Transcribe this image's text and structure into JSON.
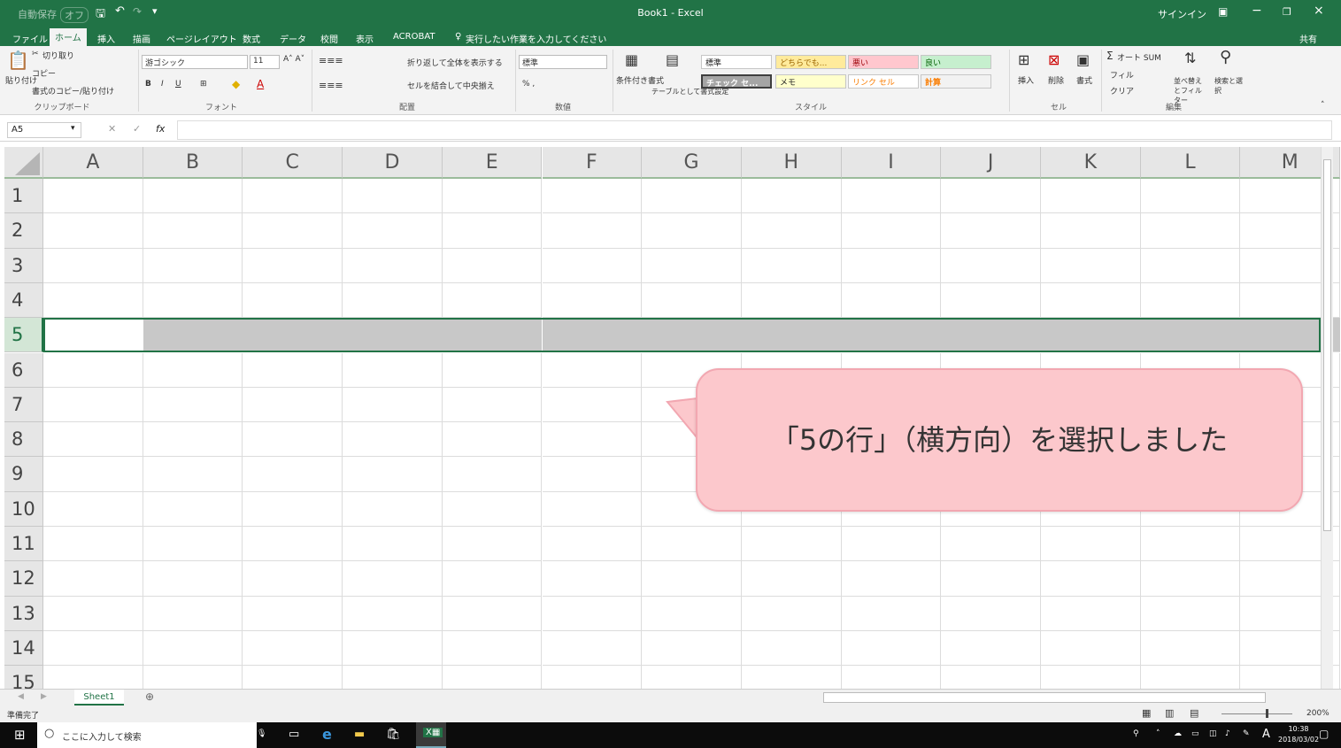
{
  "title_bar": {
    "autosave": "自動保存",
    "autosave_state": "オフ",
    "title": "Book1 - Excel",
    "signin": "サインイン"
  },
  "tabs": [
    "ファイル",
    "ホーム",
    "挿入",
    "描画",
    "ページレイアウト",
    "数式",
    "データ",
    "校閲",
    "表示",
    "ACROBAT"
  ],
  "tell_me": "実行したい作業を入力してください",
  "share": "共有",
  "ribbon": {
    "clipboard": {
      "paste": "貼り付け",
      "cut": "切り取り",
      "copy": "コピー",
      "format_painter": "書式のコピー/貼り付け",
      "label": "クリップボード"
    },
    "font": {
      "name": "游ゴシック",
      "size": "11",
      "label": "フォント"
    },
    "alignment": {
      "wrap": "折り返して全体を表示する",
      "merge": "セルを結合して中央揃え",
      "label": "配置"
    },
    "number": {
      "format": "標準",
      "label": "数値"
    },
    "styles": {
      "conditional": "条件付き書式",
      "table": "テーブルとして書式設定",
      "cells": [
        {
          "text": "標準",
          "bg": "#ffffff",
          "fg": "#222222"
        },
        {
          "text": "どちらでも...",
          "bg": "#ffeb9c",
          "fg": "#9c6500"
        },
        {
          "text": "悪い",
          "bg": "#ffc7ce",
          "fg": "#9c0006"
        },
        {
          "text": "良い",
          "bg": "#c6efce",
          "fg": "#006100"
        },
        {
          "text": "チェック セ...",
          "bg": "#a5a5a5",
          "fg": "#ffffff"
        },
        {
          "text": "メモ",
          "bg": "#ffffcc",
          "fg": "#222222"
        },
        {
          "text": "リンク セル",
          "bg": "#ffffff",
          "fg": "#fa7d00"
        },
        {
          "text": "計算",
          "bg": "#f2f2f2",
          "fg": "#fa7d00"
        }
      ],
      "label": "スタイル"
    },
    "cells": {
      "insert": "挿入",
      "delete": "削除",
      "format": "書式",
      "label": "セル"
    },
    "editing": {
      "autosum": "オート SUM",
      "fill": "フィル",
      "clear": "クリア",
      "sort": "並べ替えとフィルター",
      "find": "検索と選択",
      "label": "編集"
    }
  },
  "formula_bar": {
    "name_box": "A5",
    "fx": "fx",
    "value": ""
  },
  "columns": [
    "A",
    "B",
    "C",
    "D",
    "E",
    "F",
    "G",
    "H",
    "I",
    "J",
    "K",
    "L",
    "M"
  ],
  "rows": [
    "1",
    "2",
    "3",
    "4",
    "5",
    "6",
    "7",
    "8",
    "9",
    "10",
    "11",
    "12",
    "13",
    "14",
    "15"
  ],
  "selected_row": "5",
  "callout": "「5の行」（横方向）を選択しました",
  "sheet_tab": "Sheet1",
  "status": {
    "ready": "準備完了",
    "zoom": "200%"
  },
  "taskbar": {
    "search": "ここに入力して検索",
    "time": "10:38",
    "date": "2018/03/02",
    "ime": "A"
  },
  "colors": {
    "excel_green": "#217346",
    "selected_row": "#c8c8c8",
    "callout_bg": "#fcc8cc"
  }
}
